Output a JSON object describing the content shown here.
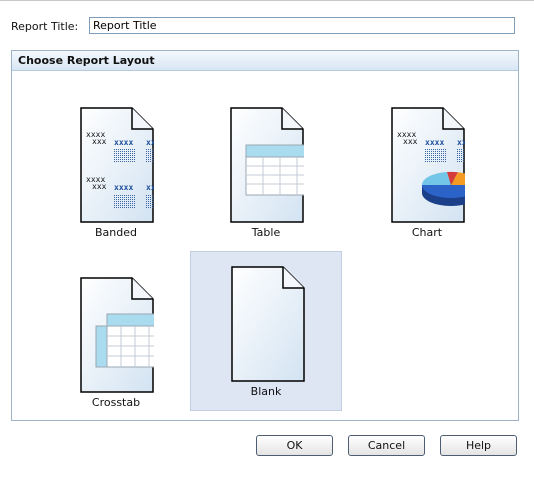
{
  "form": {
    "report_title_label": "Report Title:",
    "report_title_value": "Report Title"
  },
  "panel": {
    "title": "Choose Report Layout",
    "layouts": [
      {
        "label": "Banded",
        "icon": "banded-layout-icon",
        "selected": false
      },
      {
        "label": "Table",
        "icon": "table-layout-icon",
        "selected": false
      },
      {
        "label": "Chart",
        "icon": "chart-layout-icon",
        "selected": false
      },
      {
        "label": "Crosstab",
        "icon": "crosstab-layout-icon",
        "selected": false
      },
      {
        "label": "Blank",
        "icon": "blank-layout-icon",
        "selected": true
      }
    ]
  },
  "buttons": {
    "ok": "OK",
    "cancel": "Cancel",
    "help": "Help"
  },
  "icon_text": {
    "placeholder": "xxxx",
    "sub_placeholder": "xxx"
  },
  "colors": {
    "selected_tile": "#dde6f2",
    "panel_border": "#9fb3c8",
    "table_header": "#a9dcef",
    "pie_blue": "#2b63c9",
    "pie_orange": "#f59a23",
    "pie_red": "#d63b3b",
    "pie_cyan": "#74c6e8"
  }
}
